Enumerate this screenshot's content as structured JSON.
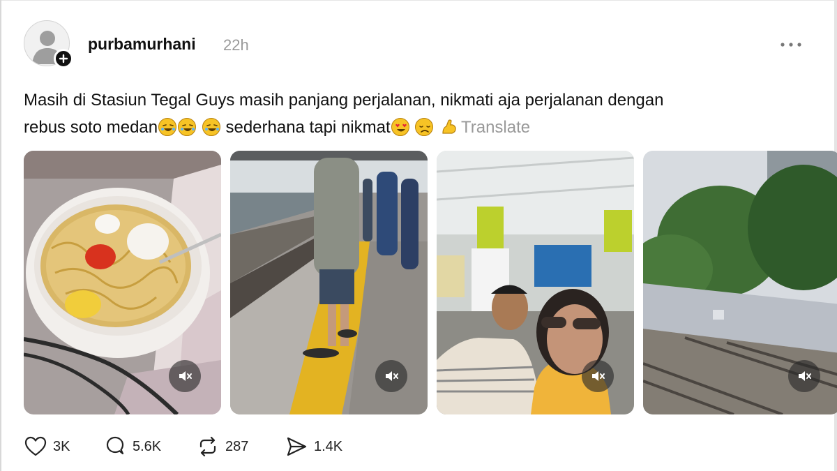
{
  "post": {
    "username": "purbamurhani",
    "time": "22h",
    "caption_line1": "Masih di Stasiun Tegal Guys masih panjang perjalanan, nikmati aja perjalanan dengan",
    "caption_line2_start": "rebus soto medan",
    "caption_line2_mid": " sederhana tapi nikmat",
    "translate_label": "Translate"
  },
  "media": [
    {
      "name": "noodle-bowl-photo",
      "description": "noodles"
    },
    {
      "name": "station-platform-photo",
      "description": "platform"
    },
    {
      "name": "selfie-photo",
      "description": "selfie"
    },
    {
      "name": "railway-tracks-photo",
      "description": "tracks"
    }
  ],
  "actions": {
    "likes": "3K",
    "replies": "5.6K",
    "reposts": "287",
    "shares": "1.4K"
  },
  "icons": {
    "avatar": "default-avatar-icon",
    "follow_badge": "plus-icon",
    "more": "more-horizontal-icon",
    "mute": "volume-muted-icon",
    "like": "heart-icon",
    "reply": "comment-icon",
    "repost": "repost-icon",
    "share": "send-icon"
  },
  "colors": {
    "text": "#111111",
    "muted": "#999999",
    "emoji": "#f7c325"
  }
}
